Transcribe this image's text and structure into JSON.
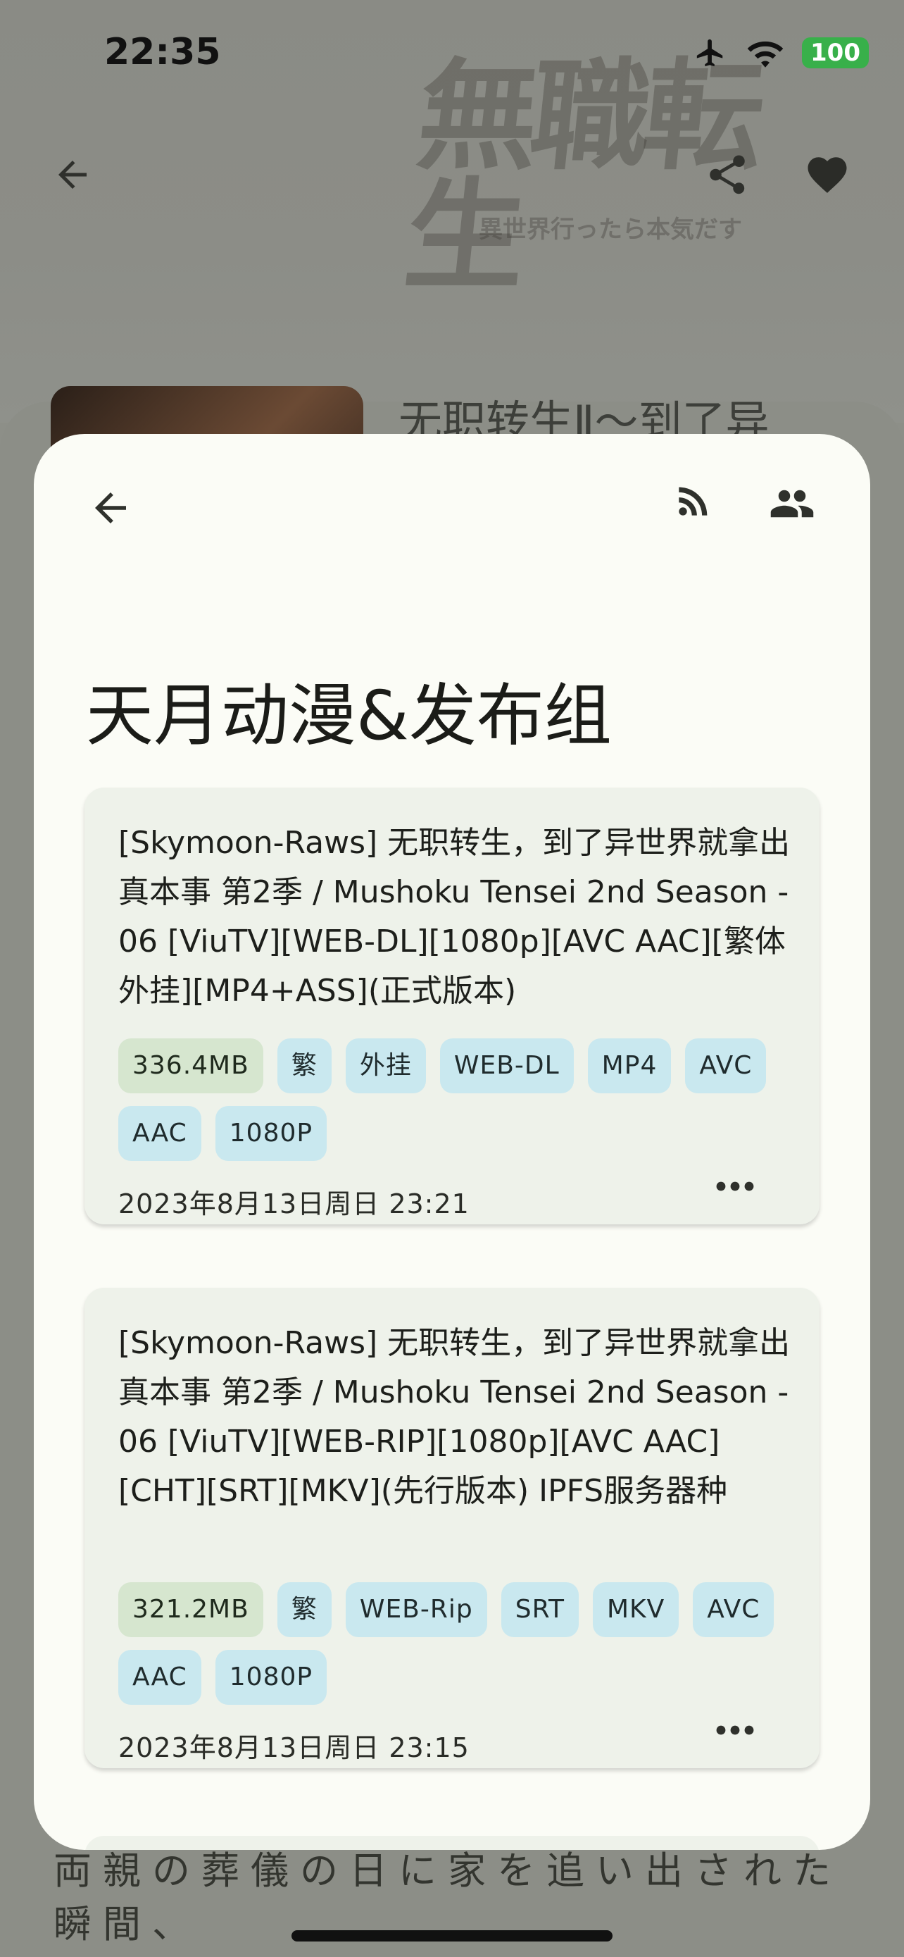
{
  "status_bar": {
    "time": "22:35",
    "battery": "100"
  },
  "background": {
    "logo_text": "無職転生",
    "logo_sub": "異世界行ったら本気だす",
    "title": "无职转生Ⅱ～到了异",
    "description": "両親の葬儀の日に家を追い出された瞬間、"
  },
  "sheet": {
    "title": "天月动漫&发布组",
    "cards": [
      {
        "title": "[Skymoon-Raws] 无职转生，到了异世界就拿出真本事 第2季 / Mushoku Tensei 2nd Season - 06 [ViuTV][WEB-DL][1080p][AVC AAC][繁体外挂][MP4+ASS](正式版本)",
        "size": "336.4MB",
        "tags": [
          "繁",
          "外挂",
          "WEB-DL",
          "MP4",
          "AVC",
          "AAC",
          "1080P"
        ],
        "date": "2023年8月13日周日 23:21"
      },
      {
        "title": "[Skymoon-Raws] 无职转生，到了异世界就拿出真本事 第2季 / Mushoku Tensei 2nd Season - 06 [ViuTV][WEB-RIP][1080p][AVC AAC][CHT][SRT][MKV](先行版本) IPFS服务器种",
        "size": "321.2MB",
        "tags": [
          "繁",
          "WEB-Rip",
          "SRT",
          "MKV",
          "AVC",
          "AAC",
          "1080P"
        ],
        "date": "2023年8月13日周日 23:15"
      }
    ]
  },
  "colors": {
    "sheet_bg": "#fbfcf6",
    "card_bg": "#eef2ea",
    "tag_bg": "#c9e8ef",
    "size_tag_bg": "#d6e6cf"
  },
  "icons": [
    "back-arrow-icon",
    "share-icon",
    "heart-icon",
    "rss-icon",
    "people-icon",
    "more-horizontal-icon",
    "airplane-icon",
    "wifi-icon"
  ]
}
